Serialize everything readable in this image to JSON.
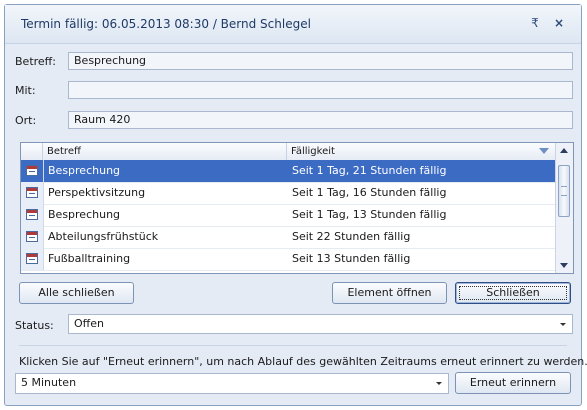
{
  "window": {
    "title": "Termin fällig: 06.05.2013 08:30 / Bernd Schlegel",
    "pin_glyph": "₹",
    "close_glyph": "×"
  },
  "fields": {
    "subject_label": "Betreff:",
    "subject_value": "Besprechung",
    "with_label": "Mit:",
    "with_value": "",
    "location_label": "Ort:",
    "location_value": "Raum 420"
  },
  "grid": {
    "columns": [
      "Betreff",
      "Fälligkeit"
    ],
    "rows": [
      {
        "subject": "Besprechung",
        "due": "Seit 1 Tag, 21 Stunden fällig",
        "selected": true
      },
      {
        "subject": "Perspektivsitzung",
        "due": "Seit 1 Tag, 16 Stunden fällig",
        "selected": false
      },
      {
        "subject": "Besprechung",
        "due": "Seit 1 Tag, 13 Stunden fällig",
        "selected": false
      },
      {
        "subject": "Abteilungsfrühstück",
        "due": "Seit 22 Stunden fällig",
        "selected": false
      },
      {
        "subject": "Fußballtraining",
        "due": "Seit 13 Stunden fällig",
        "selected": false
      }
    ]
  },
  "buttons": {
    "close_all": "Alle schließen",
    "open_item": "Element öffnen",
    "close": "Schließen",
    "snooze": "Erneut erinnern"
  },
  "status": {
    "label": "Status:",
    "value": "Offen"
  },
  "hint": "Klicken Sie auf \"Erneut erinnern\", um nach Ablauf des gewählten Zeitraums erneut erinnert zu werden.",
  "snooze_select": {
    "value": "5 Minuten"
  },
  "colors": {
    "selection": "#3c6bc4",
    "dialog_bg": "#e4ebf5",
    "title_text": "#1f3a66"
  }
}
